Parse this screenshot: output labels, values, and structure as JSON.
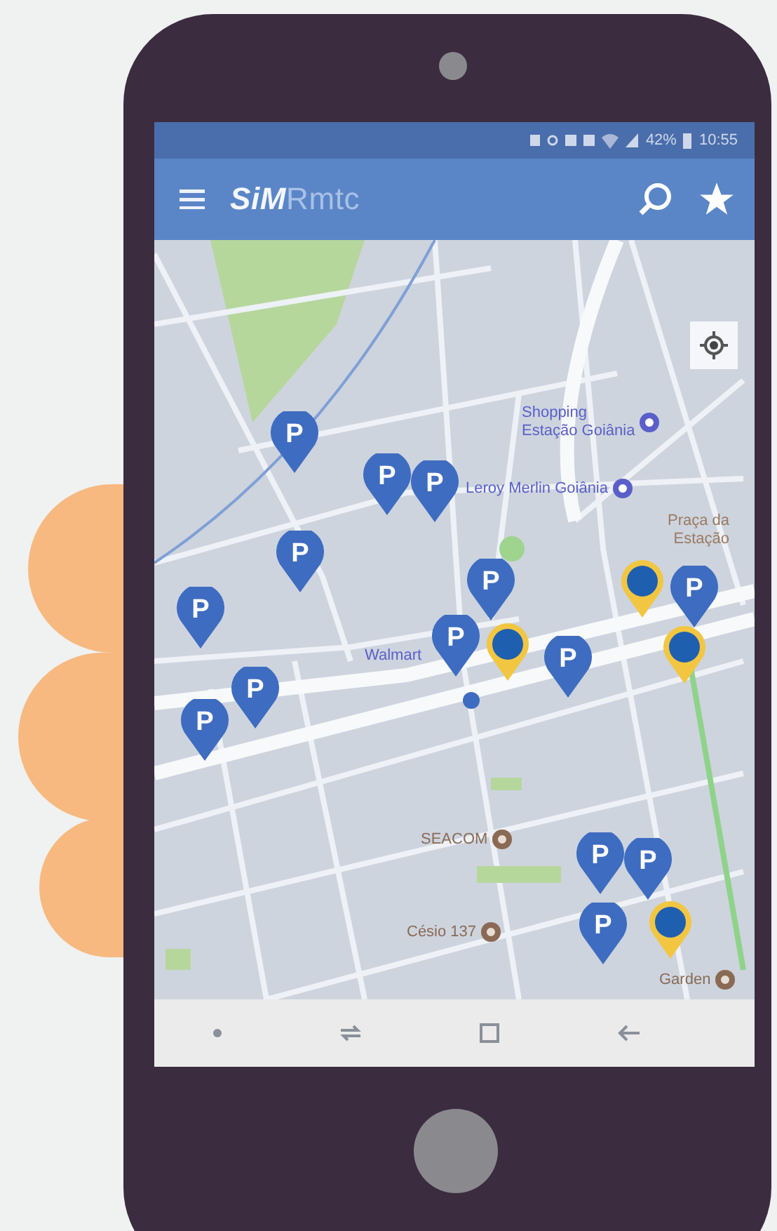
{
  "status_bar": {
    "battery": "42%",
    "time": "10:55"
  },
  "app_bar": {
    "logo": "**SiM**Rmtc"
  },
  "map": {
    "places": [
      {
        "name": "Shopping\nEstação Goiânia",
        "kind": "shop",
        "color": "#5a5fc8"
      },
      {
        "name": "Leroy Merlin Goiânia",
        "kind": "shop",
        "color": "#5a5fc8"
      },
      {
        "name": "Praça da\nEstação",
        "kind": "plain",
        "color": "#9a7a62"
      },
      {
        "name": "Walmart",
        "kind": "plain",
        "color": "#5a5fc8"
      },
      {
        "name": "SEACOM",
        "kind": "poi",
        "color": "#8a6a55"
      },
      {
        "name": "Césio 137",
        "kind": "poi",
        "color": "#8a6a55"
      },
      {
        "name": "Garden",
        "kind": "poi",
        "color": "#8a6a55"
      }
    ],
    "pins": [
      {
        "kind": "parking",
        "label": "P"
      },
      {
        "kind": "parking",
        "label": "P"
      },
      {
        "kind": "parking",
        "label": "P"
      },
      {
        "kind": "parking",
        "label": "P"
      },
      {
        "kind": "parking",
        "label": "P"
      },
      {
        "kind": "parking",
        "label": "P"
      },
      {
        "kind": "parking",
        "label": "P"
      },
      {
        "kind": "parking",
        "label": "P"
      },
      {
        "kind": "parking",
        "label": "P"
      },
      {
        "kind": "parking",
        "label": "P"
      },
      {
        "kind": "parking",
        "label": "P"
      },
      {
        "kind": "parking",
        "label": "P"
      },
      {
        "kind": "parking",
        "label": "P"
      },
      {
        "kind": "parking",
        "label": "P"
      },
      {
        "kind": "bus"
      },
      {
        "kind": "bus"
      },
      {
        "kind": "bus"
      },
      {
        "kind": "bus"
      }
    ]
  }
}
